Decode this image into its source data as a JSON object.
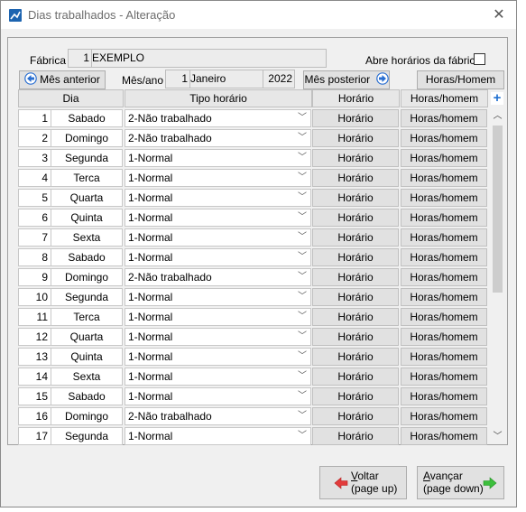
{
  "window": {
    "title": "Dias trabalhados - Alteração"
  },
  "header": {
    "fabrica_label": "Fábrica",
    "fabrica_code": "1",
    "fabrica_name": "EXEMPLO",
    "abre_horarios_label": "Abre horários da fábrica",
    "abre_horarios_checked": false,
    "mes_anterior_label": "Mês anterior",
    "mesano_label": "Mês/ano",
    "month_num": "1",
    "month_name": "Janeiro",
    "year": "2022",
    "mes_posterior_label": "Mês posterior",
    "horas_homem_label": "Horas/Homem"
  },
  "table": {
    "columns": [
      "Dia",
      "Tipo horário",
      "Horário",
      "Horas/homem"
    ],
    "horario_btn": "Horário",
    "horas_btn": "Horas/homem",
    "rows": [
      {
        "num": "1",
        "day": "Sabado",
        "tipo": "2-Não trabalhado"
      },
      {
        "num": "2",
        "day": "Domingo",
        "tipo": "2-Não trabalhado"
      },
      {
        "num": "3",
        "day": "Segunda",
        "tipo": "1-Normal"
      },
      {
        "num": "4",
        "day": "Terca",
        "tipo": "1-Normal"
      },
      {
        "num": "5",
        "day": "Quarta",
        "tipo": "1-Normal"
      },
      {
        "num": "6",
        "day": "Quinta",
        "tipo": "1-Normal"
      },
      {
        "num": "7",
        "day": "Sexta",
        "tipo": "1-Normal"
      },
      {
        "num": "8",
        "day": "Sabado",
        "tipo": "1-Normal"
      },
      {
        "num": "9",
        "day": "Domingo",
        "tipo": "2-Não trabalhado"
      },
      {
        "num": "10",
        "day": "Segunda",
        "tipo": "1-Normal"
      },
      {
        "num": "11",
        "day": "Terca",
        "tipo": "1-Normal"
      },
      {
        "num": "12",
        "day": "Quarta",
        "tipo": "1-Normal"
      },
      {
        "num": "13",
        "day": "Quinta",
        "tipo": "1-Normal"
      },
      {
        "num": "14",
        "day": "Sexta",
        "tipo": "1-Normal"
      },
      {
        "num": "15",
        "day": "Sabado",
        "tipo": "1-Normal"
      },
      {
        "num": "16",
        "day": "Domingo",
        "tipo": "2-Não trabalhado"
      },
      {
        "num": "17",
        "day": "Segunda",
        "tipo": "1-Normal"
      }
    ]
  },
  "footer": {
    "voltar_accel": "V",
    "voltar_rest": "oltar",
    "voltar_sub": "(page up)",
    "avancar_accel": "A",
    "avancar_rest": "vançar",
    "avancar_sub": "(page down)"
  },
  "icons": {
    "app": "dias-trabalhados-app-icon",
    "close": "close-icon",
    "prev": "circle-arrow-left-icon",
    "next": "circle-arrow-right-icon",
    "add": "plus-icon",
    "voltar": "red-arrow-left-icon",
    "avancar": "green-arrow-right-icon"
  },
  "colors": {
    "nav_icon": "#2a6fd1",
    "voltar_arrow": "#e23b3b",
    "avancar_arrow": "#3cbf3c",
    "plus": "#1f6fd0"
  }
}
